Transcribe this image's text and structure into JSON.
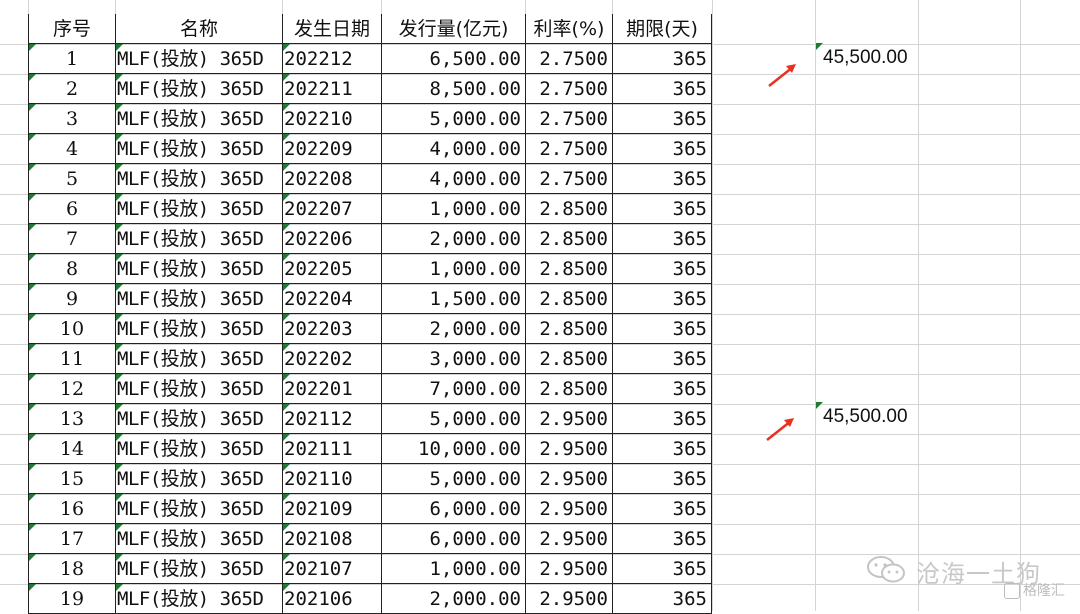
{
  "columns": [
    "序号",
    "名称",
    "发生日期",
    "发行量(亿元)",
    "利率(%)",
    "期限(天)"
  ],
  "rows": [
    {
      "idx": "1",
      "name": "MLF(投放) 365D",
      "date": "202212",
      "amount": "6,500.00",
      "rate": "2.7500",
      "term": "365"
    },
    {
      "idx": "2",
      "name": "MLF(投放) 365D",
      "date": "202211",
      "amount": "8,500.00",
      "rate": "2.7500",
      "term": "365"
    },
    {
      "idx": "3",
      "name": "MLF(投放) 365D",
      "date": "202210",
      "amount": "5,000.00",
      "rate": "2.7500",
      "term": "365"
    },
    {
      "idx": "4",
      "name": "MLF(投放) 365D",
      "date": "202209",
      "amount": "4,000.00",
      "rate": "2.7500",
      "term": "365"
    },
    {
      "idx": "5",
      "name": "MLF(投放) 365D",
      "date": "202208",
      "amount": "4,000.00",
      "rate": "2.7500",
      "term": "365"
    },
    {
      "idx": "6",
      "name": "MLF(投放) 365D",
      "date": "202207",
      "amount": "1,000.00",
      "rate": "2.8500",
      "term": "365"
    },
    {
      "idx": "7",
      "name": "MLF(投放) 365D",
      "date": "202206",
      "amount": "2,000.00",
      "rate": "2.8500",
      "term": "365"
    },
    {
      "idx": "8",
      "name": "MLF(投放) 365D",
      "date": "202205",
      "amount": "1,000.00",
      "rate": "2.8500",
      "term": "365"
    },
    {
      "idx": "9",
      "name": "MLF(投放) 365D",
      "date": "202204",
      "amount": "1,500.00",
      "rate": "2.8500",
      "term": "365"
    },
    {
      "idx": "10",
      "name": "MLF(投放) 365D",
      "date": "202203",
      "amount": "2,000.00",
      "rate": "2.8500",
      "term": "365"
    },
    {
      "idx": "11",
      "name": "MLF(投放) 365D",
      "date": "202202",
      "amount": "3,000.00",
      "rate": "2.8500",
      "term": "365"
    },
    {
      "idx": "12",
      "name": "MLF(投放) 365D",
      "date": "202201",
      "amount": "7,000.00",
      "rate": "2.8500",
      "term": "365"
    },
    {
      "idx": "13",
      "name": "MLF(投放) 365D",
      "date": "202112",
      "amount": "5,000.00",
      "rate": "2.9500",
      "term": "365"
    },
    {
      "idx": "14",
      "name": "MLF(投放) 365D",
      "date": "202111",
      "amount": "10,000.00",
      "rate": "2.9500",
      "term": "365"
    },
    {
      "idx": "15",
      "name": "MLF(投放) 365D",
      "date": "202110",
      "amount": "5,000.00",
      "rate": "2.9500",
      "term": "365"
    },
    {
      "idx": "16",
      "name": "MLF(投放) 365D",
      "date": "202109",
      "amount": "6,000.00",
      "rate": "2.9500",
      "term": "365"
    },
    {
      "idx": "17",
      "name": "MLF(投放) 365D",
      "date": "202108",
      "amount": "6,000.00",
      "rate": "2.9500",
      "term": "365"
    },
    {
      "idx": "18",
      "name": "MLF(投放) 365D",
      "date": "202107",
      "amount": "1,000.00",
      "rate": "2.9500",
      "term": "365"
    },
    {
      "idx": "19",
      "name": "MLF(投放) 365D",
      "date": "202106",
      "amount": "2,000.00",
      "rate": "2.9500",
      "term": "365"
    }
  ],
  "sums": [
    "45,500.00",
    "45,500.00"
  ],
  "watermark": {
    "text": "沧海一土狗",
    "brand": "格隆汇"
  },
  "colors": {
    "arrow": "#e8311f",
    "triangle": "#1e7b34",
    "grid": "#d4d4d4",
    "border": "#222222"
  },
  "icons": [
    "error-indicator-triangle",
    "red-arrow",
    "wechat-icon"
  ]
}
